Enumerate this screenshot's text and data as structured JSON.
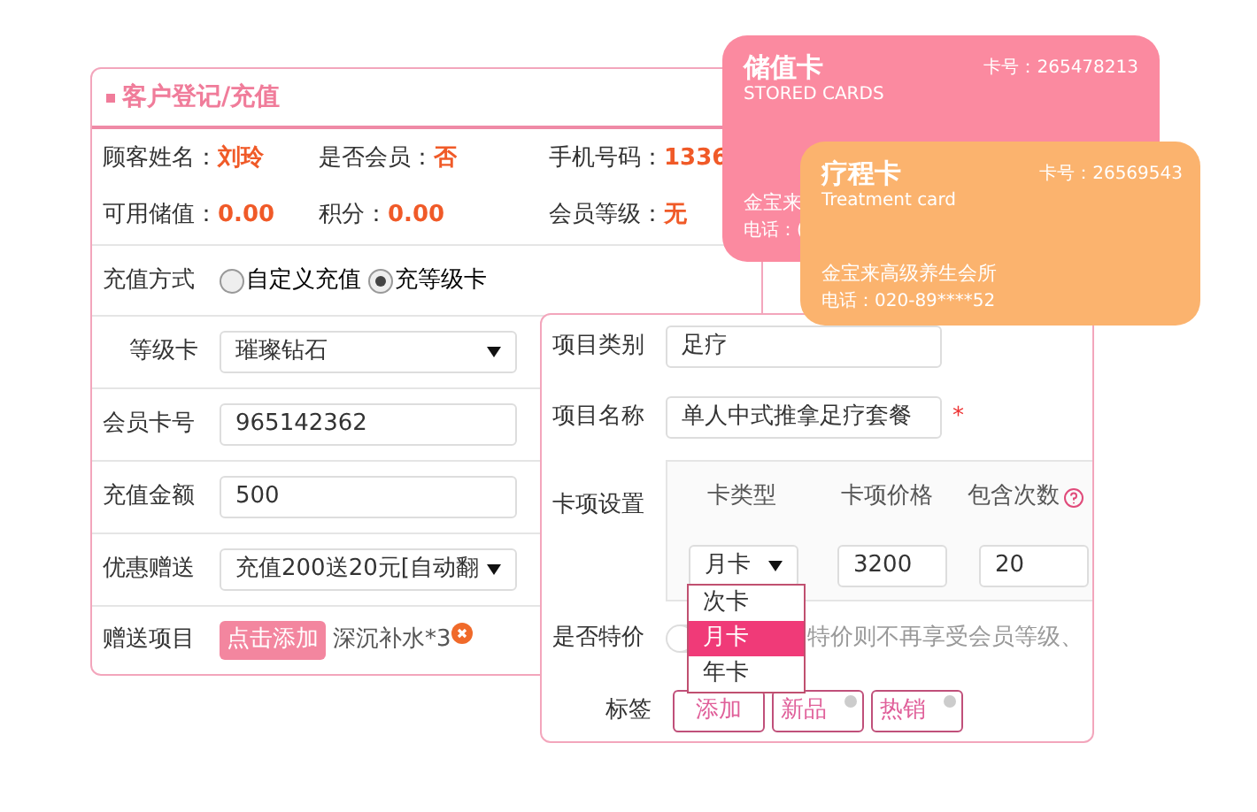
{
  "panel": {
    "title": "客户登记/充值",
    "info": [
      {
        "label": "顾客姓名：",
        "value": "刘玲"
      },
      {
        "label": "是否会员：",
        "value": "否"
      },
      {
        "label": "手机号码：",
        "value": "1336"
      },
      {
        "label": "可用储值：",
        "value": "0.00"
      },
      {
        "label": "积分：",
        "value": "0.00"
      },
      {
        "label": "会员等级：",
        "value": "无"
      }
    ],
    "charge_method": {
      "label": "充值方式",
      "options": [
        {
          "label": "自定义充值",
          "selected": false
        },
        {
          "label": "充等级卡",
          "selected": true
        }
      ]
    },
    "grade_card": {
      "label": "等级卡",
      "value": "璀璨钻石"
    },
    "card_number": {
      "label": "会员卡号",
      "value": "965142362"
    },
    "amount": {
      "label": "充值金额",
      "value": "500"
    },
    "discount": {
      "label": "优惠赠送",
      "value": "充值200送20元[自动翻"
    },
    "gift": {
      "label": "赠送项目",
      "button": "点击添加",
      "item": "深沉补水*3"
    }
  },
  "item_panel": {
    "category": {
      "label": "项目类别",
      "value": "足疗"
    },
    "name": {
      "label": "项目名称",
      "value": "单人中式推拿足疗套餐",
      "required": "*"
    },
    "card_settings": {
      "label": "卡项设置",
      "columns": [
        "卡类型",
        "卡项价格",
        "包含次数"
      ],
      "type": "月卡",
      "price": "3200",
      "count": "20",
      "options": [
        {
          "label": "次卡",
          "selected": false
        },
        {
          "label": "月卡",
          "selected": true
        },
        {
          "label": "年卡",
          "selected": false
        }
      ]
    },
    "special": {
      "label": "是否特价",
      "on": false,
      "note": "特价则不再享受会员等级、"
    },
    "tags": {
      "label": "标签",
      "add": "添加",
      "items": [
        "新品",
        "热销"
      ]
    }
  },
  "cards": [
    {
      "title": "储值卡",
      "subtitle": "STORED CARDS",
      "number": "卡号：265478213",
      "shop": "金宝来",
      "phone": "电话：(",
      "color": "#fb8aa0"
    },
    {
      "title": "疗程卡",
      "subtitle": "Treatment card",
      "number": "卡号：26569543",
      "shop": "金宝来高级养生会所",
      "phone": "电话：020-89****52",
      "color": "#fbb36e"
    }
  ]
}
